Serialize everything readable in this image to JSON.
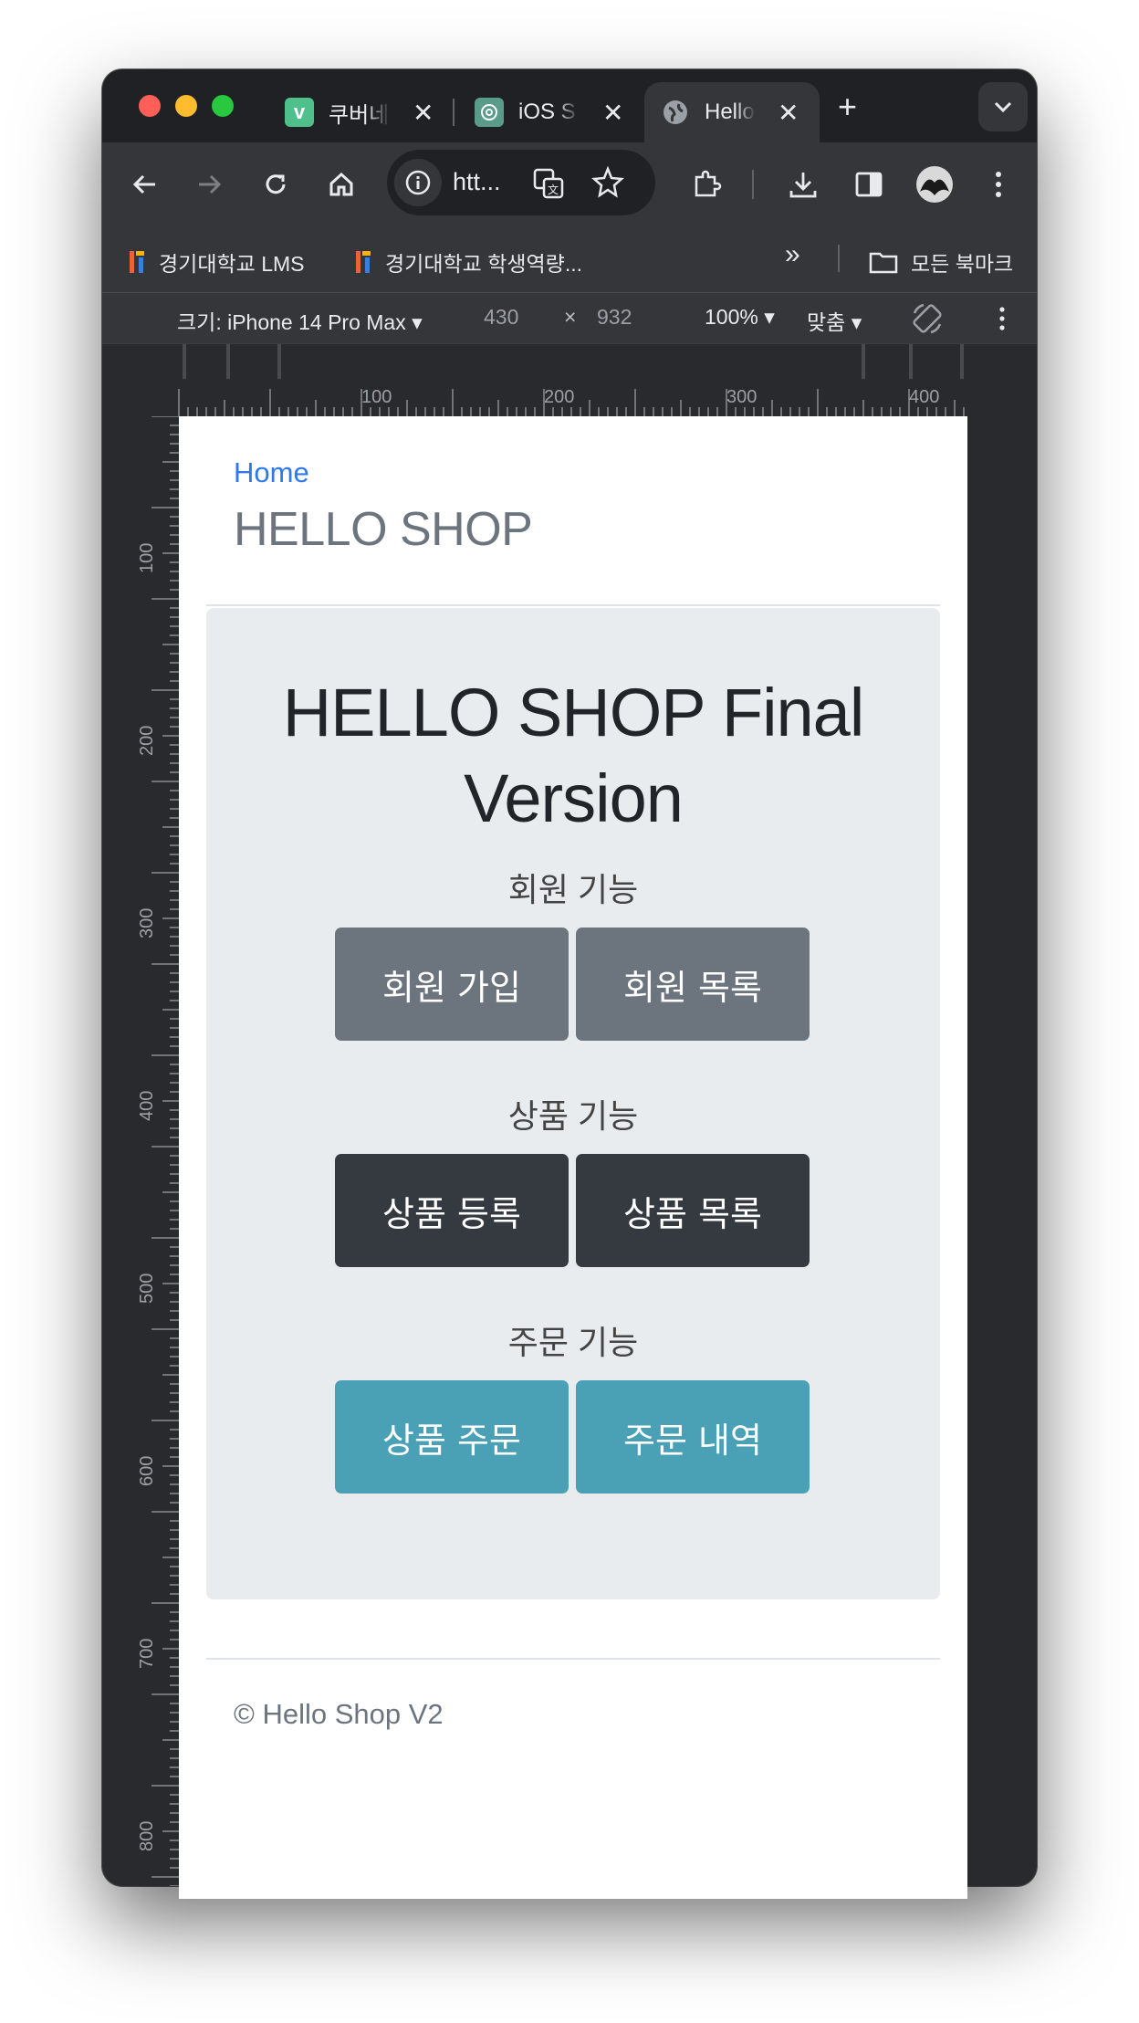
{
  "browser": {
    "tabs": [
      {
        "title": "쿠버네",
        "favicon_letter": "v",
        "favicon_color": "#4fbf8c"
      },
      {
        "title": "iOS S",
        "favicon_letter": "",
        "favicon_color": "#5a9b8a"
      },
      {
        "title": "Hello",
        "favicon_letter": "",
        "favicon_color": "#9aa0a6"
      }
    ],
    "new_tab": "+",
    "address_text": "htt...",
    "bookmarks": [
      {
        "label": "경기대학교 LMS"
      },
      {
        "label": "경기대학교 학생역량..."
      }
    ],
    "overflow_chevron": "»",
    "all_bookmarks": "모든 북마크"
  },
  "device_toolbar": {
    "size_label": "크기: iPhone 14 Pro Max ▾",
    "width": "430",
    "times": "×",
    "height": "932",
    "zoom": "100% ▾",
    "fit": "맞춤 ▾"
  },
  "ruler": {
    "h_labels": [
      "100",
      "200",
      "300",
      "400"
    ],
    "v_labels": [
      "100",
      "200",
      "300",
      "400",
      "500",
      "600",
      "700",
      "800"
    ]
  },
  "page": {
    "home_link": "Home",
    "brand": "HELLO SHOP",
    "title_line1": "HELLO SHOP Final",
    "title_line2": "Version",
    "member_section": "회원 기능",
    "member_join": "회원 가입",
    "member_list": "회원 목록",
    "item_section": "상품 기능",
    "item_register": "상품 등록",
    "item_list": "상품 목록",
    "order_section": "주문 기능",
    "order_item": "상품 주문",
    "order_history": "주문 내역",
    "footer": "© Hello Shop V2"
  },
  "colors": {
    "secondary": "#6c757d",
    "dark": "#343a40",
    "info": "#4aa0b5",
    "link": "#2f78f0",
    "jumbotron": "#e9ecef"
  }
}
